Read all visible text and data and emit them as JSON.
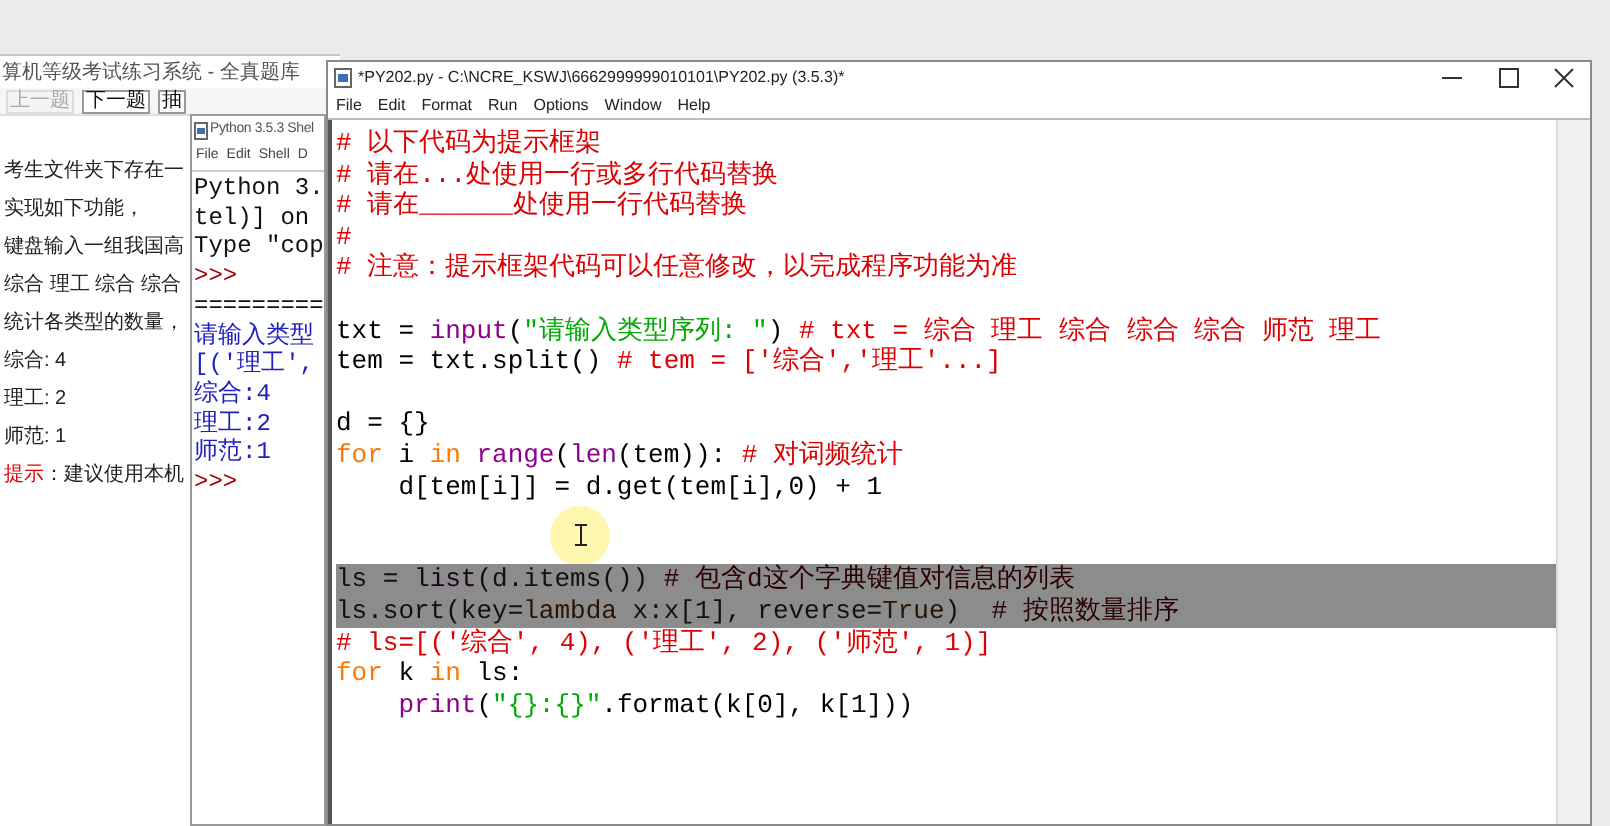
{
  "exam_window": {
    "title": "算机等级考试练习系统 - 全真题库",
    "toolbar": [
      {
        "label": "上一题",
        "disabled": true
      },
      {
        "label": "下一题",
        "disabled": false
      },
      {
        "label": "抽",
        "disabled": false
      }
    ],
    "lines": [
      {
        "kind": "text",
        "text": "考生文件夹下存在一"
      },
      {
        "kind": "text",
        "text": "实现如下功能，"
      },
      {
        "kind": "text",
        "text": "键盘输入一组我国高"
      },
      {
        "kind": "text",
        "text": "综合 理工 综合 综合"
      },
      {
        "kind": "text",
        "text": "统计各类型的数量，"
      },
      {
        "kind": "text",
        "text": "综合: 4"
      },
      {
        "kind": "text",
        "text": "理工: 2"
      },
      {
        "kind": "text",
        "text": "师范: 1"
      },
      {
        "kind": "hint",
        "label": "提示",
        "text": "：建议使用本机"
      }
    ]
  },
  "shell_window": {
    "title": "Python 3.5.3 Shel",
    "menu": [
      "File",
      "Edit",
      "Shell",
      "D"
    ],
    "lines": [
      {
        "kind": "output",
        "text": "Python 3."
      },
      {
        "kind": "output",
        "text": "tel)] on"
      },
      {
        "kind": "output",
        "text": "Type \"cop"
      },
      {
        "kind": "prompt",
        "text": ">>>"
      },
      {
        "kind": "output",
        "text": "========="
      },
      {
        "kind": "stdout",
        "text": "请输入类型"
      },
      {
        "kind": "stdout",
        "text": "[('理工',"
      },
      {
        "kind": "stdout",
        "text": "综合:4"
      },
      {
        "kind": "stdout",
        "text": "理工:2"
      },
      {
        "kind": "stdout",
        "text": "师范:1"
      },
      {
        "kind": "prompt",
        "text": ">>>"
      }
    ]
  },
  "editor_window": {
    "title": "*PY202.py - C:\\NCRE_KSWJ\\6662999999010101\\PY202.py (3.5.3)*",
    "menu": [
      "File",
      "Edit",
      "Format",
      "Run",
      "Options",
      "Window",
      "Help"
    ],
    "code": [
      {
        "kind": "code",
        "selected": false,
        "tokens": [
          {
            "kind": "comment",
            "text": "# 以下代码为提示框架"
          }
        ]
      },
      {
        "kind": "code",
        "selected": false,
        "tokens": [
          {
            "kind": "comment",
            "text": "# 请在...处使用一行或多行代码替换"
          }
        ]
      },
      {
        "kind": "code",
        "selected": false,
        "tokens": [
          {
            "kind": "comment",
            "text": "# 请在______处使用一行代码替换"
          }
        ]
      },
      {
        "kind": "code",
        "selected": false,
        "tokens": [
          {
            "kind": "comment",
            "text": "#"
          }
        ]
      },
      {
        "kind": "code",
        "selected": false,
        "tokens": [
          {
            "kind": "comment",
            "text": "# 注意：提示框架代码可以任意修改，以完成程序功能为准"
          }
        ]
      },
      {
        "kind": "blank"
      },
      {
        "kind": "code",
        "selected": false,
        "tokens": [
          {
            "kind": "plain",
            "text": "txt = "
          },
          {
            "kind": "builtin",
            "text": "input"
          },
          {
            "kind": "plain",
            "text": "("
          },
          {
            "kind": "string",
            "text": "\"请输入类型序列: \""
          },
          {
            "kind": "plain",
            "text": ") "
          },
          {
            "kind": "comment",
            "text": "# txt = 综合 理工 综合 综合 综合 师范 理工"
          }
        ]
      },
      {
        "kind": "code",
        "selected": false,
        "tokens": [
          {
            "kind": "plain",
            "text": "tem = txt.split() "
          },
          {
            "kind": "comment",
            "text": "# tem = ['综合','理工'...]"
          }
        ]
      },
      {
        "kind": "blank"
      },
      {
        "kind": "code",
        "selected": false,
        "tokens": [
          {
            "kind": "plain",
            "text": "d = {}"
          }
        ]
      },
      {
        "kind": "code",
        "selected": false,
        "tokens": [
          {
            "kind": "keyword",
            "text": "for"
          },
          {
            "kind": "plain",
            "text": " i "
          },
          {
            "kind": "keyword",
            "text": "in"
          },
          {
            "kind": "builtin",
            "text": " range"
          },
          {
            "kind": "plain",
            "text": "("
          },
          {
            "kind": "builtin",
            "text": "len"
          },
          {
            "kind": "plain",
            "text": "(tem)): "
          },
          {
            "kind": "comment",
            "text": "# 对词频统计"
          }
        ]
      },
      {
        "kind": "code",
        "selected": false,
        "tokens": [
          {
            "kind": "plain",
            "text": "    d[tem[i]] = d.get(tem[i],0) + 1"
          }
        ]
      },
      {
        "kind": "blank"
      },
      {
        "kind": "blank"
      },
      {
        "kind": "code",
        "selected": true,
        "tokens": [
          {
            "kind": "plain",
            "text": "ls = "
          },
          {
            "kind": "builtin",
            "text": "list"
          },
          {
            "kind": "plain",
            "text": "(d.items()) "
          },
          {
            "kind": "comment",
            "text": "# 包含d这个字典键值对信息的列表"
          }
        ]
      },
      {
        "kind": "code",
        "selected": true,
        "tokens": [
          {
            "kind": "plain",
            "text": "ls.sort(key="
          },
          {
            "kind": "keyword",
            "text": "lambda"
          },
          {
            "kind": "plain",
            "text": " x:x[1], reverse="
          },
          {
            "kind": "keyword",
            "text": "True"
          },
          {
            "kind": "plain",
            "text": ")  "
          },
          {
            "kind": "comment",
            "text": "# 按照数量排序"
          }
        ]
      },
      {
        "kind": "code",
        "selected": false,
        "tokens": [
          {
            "kind": "comment",
            "text": "# ls=[('综合', 4), ('理工', 2), ('师范', 1)]"
          }
        ]
      },
      {
        "kind": "code",
        "selected": false,
        "tokens": [
          {
            "kind": "keyword",
            "text": "for"
          },
          {
            "kind": "plain",
            "text": " k "
          },
          {
            "kind": "keyword",
            "text": "in"
          },
          {
            "kind": "plain",
            "text": " ls:"
          }
        ]
      },
      {
        "kind": "code",
        "selected": false,
        "tokens": [
          {
            "kind": "builtin",
            "text": "    print"
          },
          {
            "kind": "plain",
            "text": "("
          },
          {
            "kind": "string",
            "text": "\"{}:{}\""
          },
          {
            "kind": "plain",
            "text": ".format(k[0], k[1]))"
          }
        ]
      }
    ]
  }
}
